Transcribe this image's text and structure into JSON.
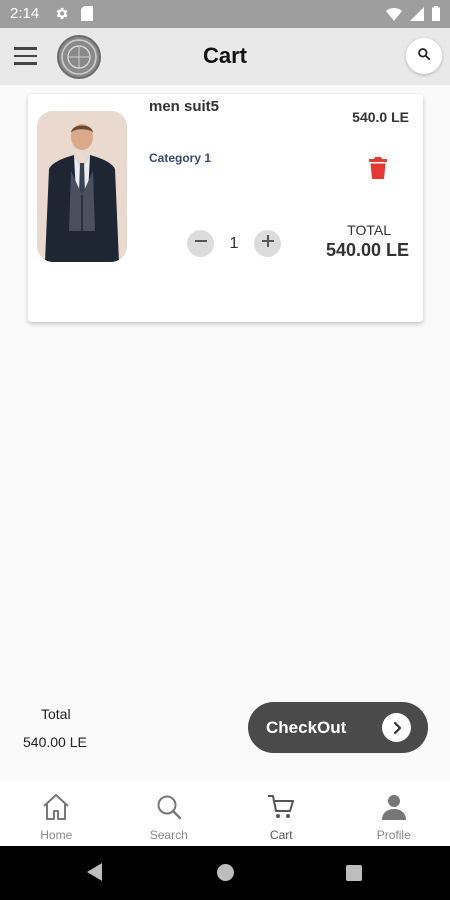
{
  "status_bar": {
    "time": "2:14",
    "icons": [
      "gear-icon",
      "sd-card-icon",
      "wifi-icon",
      "signal-icon",
      "battery-icon"
    ]
  },
  "app_bar": {
    "title": "Cart",
    "icons": [
      "menu-icon",
      "app-logo",
      "search-icon"
    ]
  },
  "cart": {
    "items": [
      {
        "name": "men suit5",
        "price": "540.0 LE",
        "category": "Category 1",
        "quantity": "1",
        "total_label": "TOTAL",
        "total": "540.00 LE"
      }
    ]
  },
  "summary": {
    "total_label": "Total",
    "total_value": "540.00 LE",
    "checkout_label": "CheckOut"
  },
  "bottom_nav": {
    "items": [
      {
        "label": "Home",
        "icon": "home-icon"
      },
      {
        "label": "Search",
        "icon": "search-icon"
      },
      {
        "label": "Cart",
        "icon": "cart-icon"
      },
      {
        "label": "Profile",
        "icon": "profile-icon"
      }
    ],
    "active": "Cart"
  },
  "colors": {
    "app_bar": "#e9e9e9",
    "delete": "#e53935",
    "category": "#3b4a6b",
    "checkout": "#4a4a4a"
  }
}
